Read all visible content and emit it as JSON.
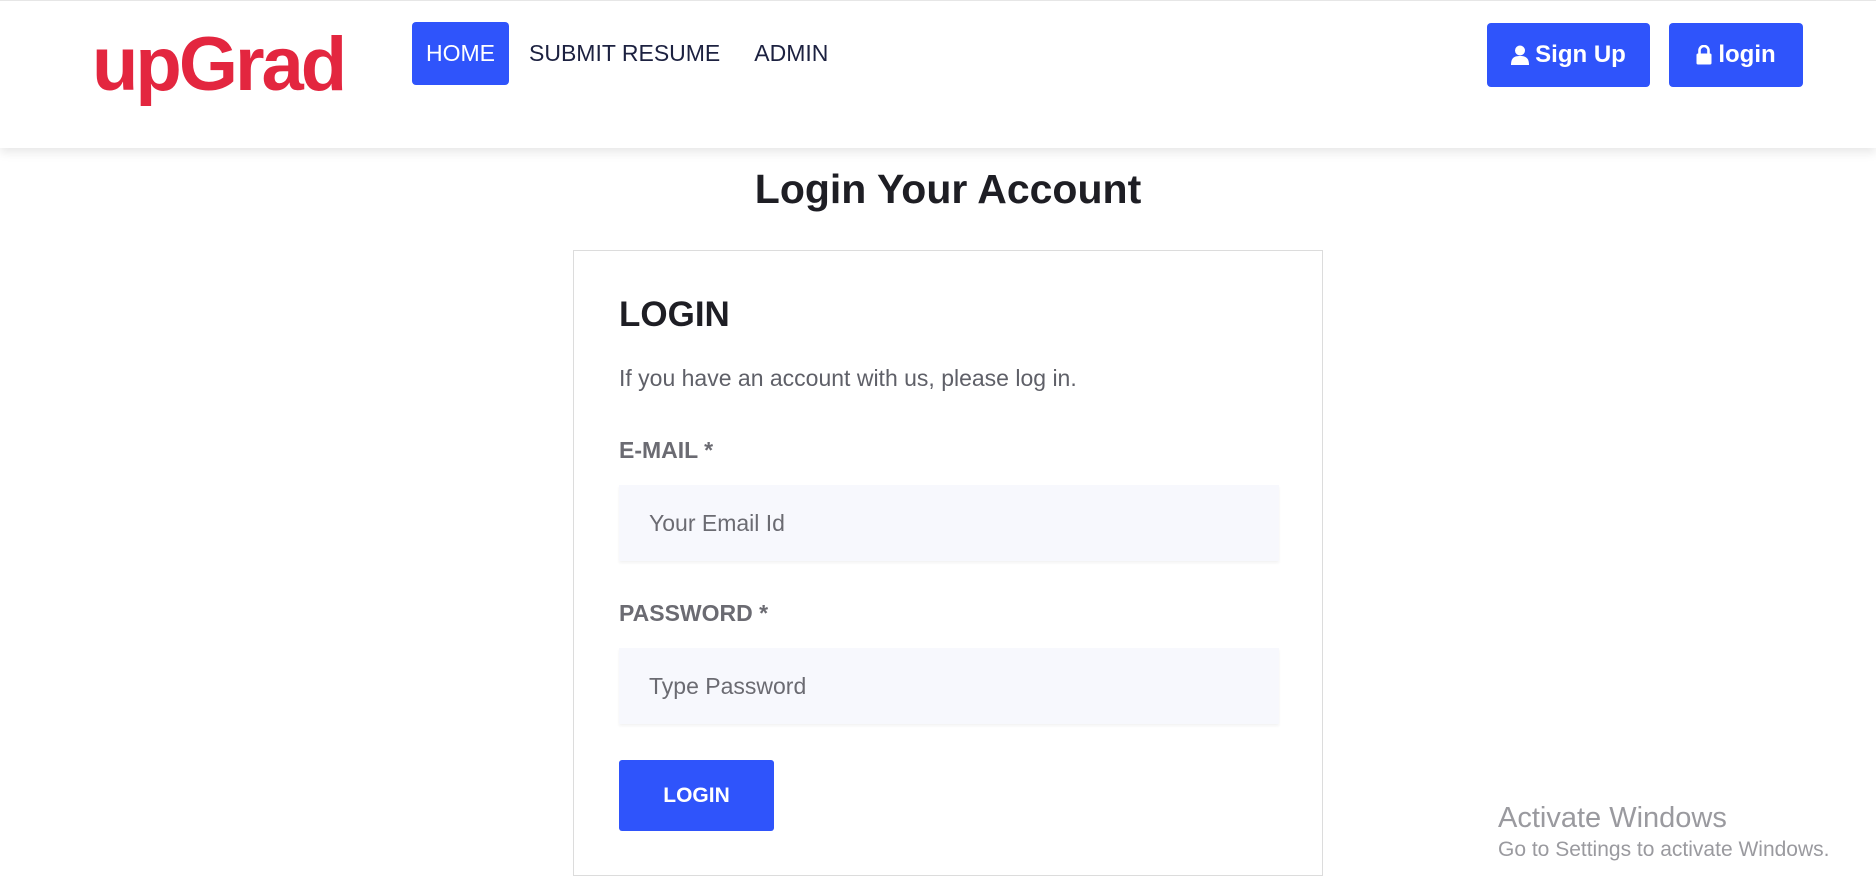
{
  "header": {
    "logo": "upGrad",
    "nav": [
      {
        "label": "HOME",
        "active": true
      },
      {
        "label": "SUBMIT RESUME",
        "active": false
      },
      {
        "label": "ADMIN",
        "active": false
      }
    ],
    "signup_label": "Sign Up",
    "login_label": "login",
    "signup_icon": "user-icon",
    "login_icon": "lock-icon"
  },
  "page": {
    "title": "Login Your Account"
  },
  "login_form": {
    "heading": "LOGIN",
    "description": "If you have an account with us, please log in.",
    "email_label": "E-MAIL *",
    "email_placeholder": "Your Email Id",
    "password_label": "PASSWORD *",
    "password_placeholder": "Type Password",
    "submit_label": "LOGIN"
  },
  "watermark": {
    "title": "Activate Windows",
    "subtitle": "Go to Settings to activate Windows."
  },
  "colors": {
    "brand_red": "#e3263f",
    "primary_blue": "#2f54fb",
    "input_bg": "#f7f8fd",
    "text_dark": "#1e1e24",
    "text_muted": "#5f6068"
  }
}
